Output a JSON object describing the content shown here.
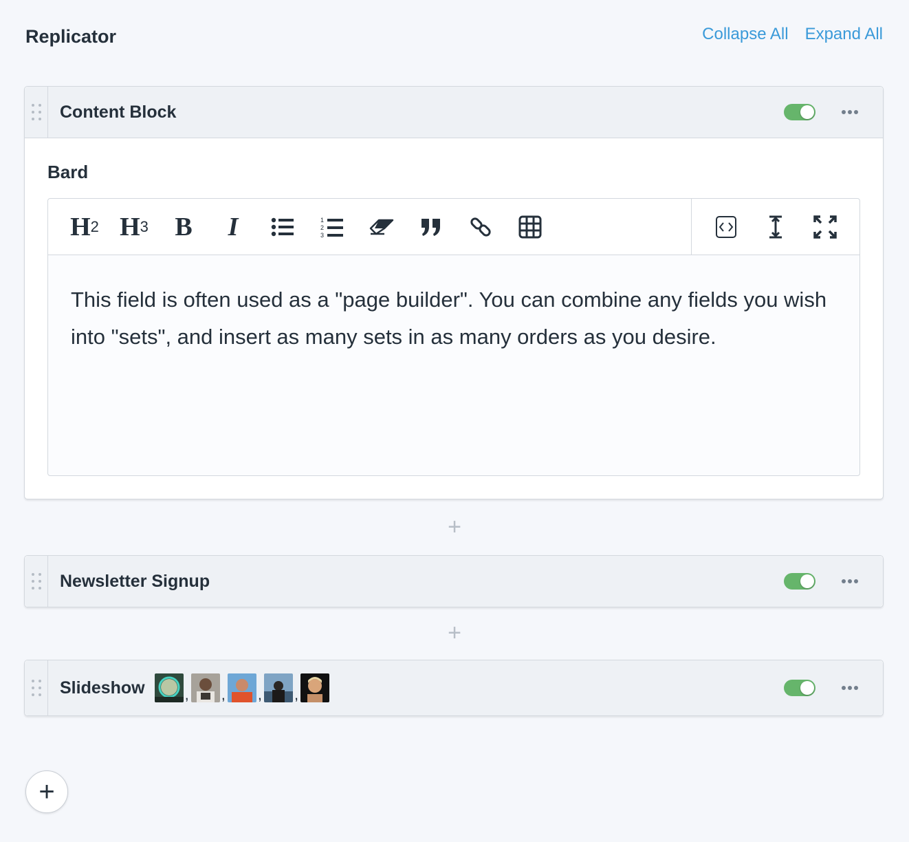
{
  "header": {
    "title": "Replicator",
    "collapse_all": "Collapse All",
    "expand_all": "Expand All"
  },
  "sets": [
    {
      "title": "Content Block",
      "enabled": true,
      "field_label": "Bard",
      "content": "This field is often used as a \"page builder\". You can combine any fields you wish into \"sets\", and insert as many sets in as many orders as you desire."
    },
    {
      "title": "Newsletter Signup",
      "enabled": true
    },
    {
      "title": "Slideshow",
      "enabled": true,
      "thumbnail_separator": ","
    }
  ],
  "toolbar": {
    "h2_label": "H",
    "h2_level": "2",
    "h3_label": "H",
    "h3_level": "3",
    "bold_label": "B",
    "italic_label": "I",
    "left_icons": [
      "unordered-list-icon",
      "ordered-list-icon",
      "eraser-icon",
      "quote-icon",
      "link-icon",
      "table-icon"
    ],
    "right_icons": [
      "code-icon",
      "text-height-icon",
      "expand-icon"
    ]
  },
  "separators": {
    "add_symbol": "+"
  },
  "add_set": {
    "symbol": "+"
  },
  "colors": {
    "accent_link": "#3a9ad9",
    "toggle_on": "#66b56b",
    "background": "#f5f7fb",
    "header_bg": "#eef1f5"
  }
}
